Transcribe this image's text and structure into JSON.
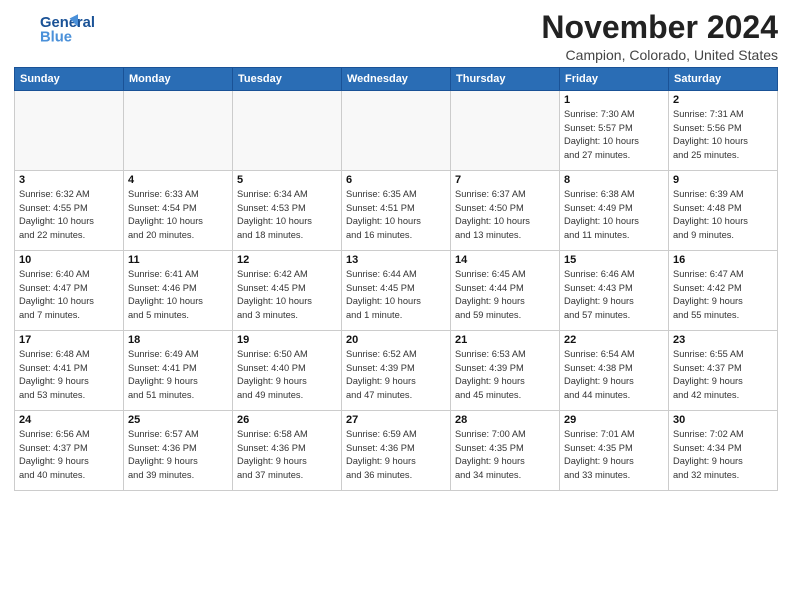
{
  "header": {
    "logo_line1": "General",
    "logo_line2": "Blue",
    "month": "November 2024",
    "location": "Campion, Colorado, United States"
  },
  "weekdays": [
    "Sunday",
    "Monday",
    "Tuesday",
    "Wednesday",
    "Thursday",
    "Friday",
    "Saturday"
  ],
  "weeks": [
    [
      {
        "day": "",
        "info": ""
      },
      {
        "day": "",
        "info": ""
      },
      {
        "day": "",
        "info": ""
      },
      {
        "day": "",
        "info": ""
      },
      {
        "day": "",
        "info": ""
      },
      {
        "day": "1",
        "info": "Sunrise: 7:30 AM\nSunset: 5:57 PM\nDaylight: 10 hours\nand 27 minutes."
      },
      {
        "day": "2",
        "info": "Sunrise: 7:31 AM\nSunset: 5:56 PM\nDaylight: 10 hours\nand 25 minutes."
      }
    ],
    [
      {
        "day": "3",
        "info": "Sunrise: 6:32 AM\nSunset: 4:55 PM\nDaylight: 10 hours\nand 22 minutes."
      },
      {
        "day": "4",
        "info": "Sunrise: 6:33 AM\nSunset: 4:54 PM\nDaylight: 10 hours\nand 20 minutes."
      },
      {
        "day": "5",
        "info": "Sunrise: 6:34 AM\nSunset: 4:53 PM\nDaylight: 10 hours\nand 18 minutes."
      },
      {
        "day": "6",
        "info": "Sunrise: 6:35 AM\nSunset: 4:51 PM\nDaylight: 10 hours\nand 16 minutes."
      },
      {
        "day": "7",
        "info": "Sunrise: 6:37 AM\nSunset: 4:50 PM\nDaylight: 10 hours\nand 13 minutes."
      },
      {
        "day": "8",
        "info": "Sunrise: 6:38 AM\nSunset: 4:49 PM\nDaylight: 10 hours\nand 11 minutes."
      },
      {
        "day": "9",
        "info": "Sunrise: 6:39 AM\nSunset: 4:48 PM\nDaylight: 10 hours\nand 9 minutes."
      }
    ],
    [
      {
        "day": "10",
        "info": "Sunrise: 6:40 AM\nSunset: 4:47 PM\nDaylight: 10 hours\nand 7 minutes."
      },
      {
        "day": "11",
        "info": "Sunrise: 6:41 AM\nSunset: 4:46 PM\nDaylight: 10 hours\nand 5 minutes."
      },
      {
        "day": "12",
        "info": "Sunrise: 6:42 AM\nSunset: 4:45 PM\nDaylight: 10 hours\nand 3 minutes."
      },
      {
        "day": "13",
        "info": "Sunrise: 6:44 AM\nSunset: 4:45 PM\nDaylight: 10 hours\nand 1 minute."
      },
      {
        "day": "14",
        "info": "Sunrise: 6:45 AM\nSunset: 4:44 PM\nDaylight: 9 hours\nand 59 minutes."
      },
      {
        "day": "15",
        "info": "Sunrise: 6:46 AM\nSunset: 4:43 PM\nDaylight: 9 hours\nand 57 minutes."
      },
      {
        "day": "16",
        "info": "Sunrise: 6:47 AM\nSunset: 4:42 PM\nDaylight: 9 hours\nand 55 minutes."
      }
    ],
    [
      {
        "day": "17",
        "info": "Sunrise: 6:48 AM\nSunset: 4:41 PM\nDaylight: 9 hours\nand 53 minutes."
      },
      {
        "day": "18",
        "info": "Sunrise: 6:49 AM\nSunset: 4:41 PM\nDaylight: 9 hours\nand 51 minutes."
      },
      {
        "day": "19",
        "info": "Sunrise: 6:50 AM\nSunset: 4:40 PM\nDaylight: 9 hours\nand 49 minutes."
      },
      {
        "day": "20",
        "info": "Sunrise: 6:52 AM\nSunset: 4:39 PM\nDaylight: 9 hours\nand 47 minutes."
      },
      {
        "day": "21",
        "info": "Sunrise: 6:53 AM\nSunset: 4:39 PM\nDaylight: 9 hours\nand 45 minutes."
      },
      {
        "day": "22",
        "info": "Sunrise: 6:54 AM\nSunset: 4:38 PM\nDaylight: 9 hours\nand 44 minutes."
      },
      {
        "day": "23",
        "info": "Sunrise: 6:55 AM\nSunset: 4:37 PM\nDaylight: 9 hours\nand 42 minutes."
      }
    ],
    [
      {
        "day": "24",
        "info": "Sunrise: 6:56 AM\nSunset: 4:37 PM\nDaylight: 9 hours\nand 40 minutes."
      },
      {
        "day": "25",
        "info": "Sunrise: 6:57 AM\nSunset: 4:36 PM\nDaylight: 9 hours\nand 39 minutes."
      },
      {
        "day": "26",
        "info": "Sunrise: 6:58 AM\nSunset: 4:36 PM\nDaylight: 9 hours\nand 37 minutes."
      },
      {
        "day": "27",
        "info": "Sunrise: 6:59 AM\nSunset: 4:36 PM\nDaylight: 9 hours\nand 36 minutes."
      },
      {
        "day": "28",
        "info": "Sunrise: 7:00 AM\nSunset: 4:35 PM\nDaylight: 9 hours\nand 34 minutes."
      },
      {
        "day": "29",
        "info": "Sunrise: 7:01 AM\nSunset: 4:35 PM\nDaylight: 9 hours\nand 33 minutes."
      },
      {
        "day": "30",
        "info": "Sunrise: 7:02 AM\nSunset: 4:34 PM\nDaylight: 9 hours\nand 32 minutes."
      }
    ]
  ]
}
